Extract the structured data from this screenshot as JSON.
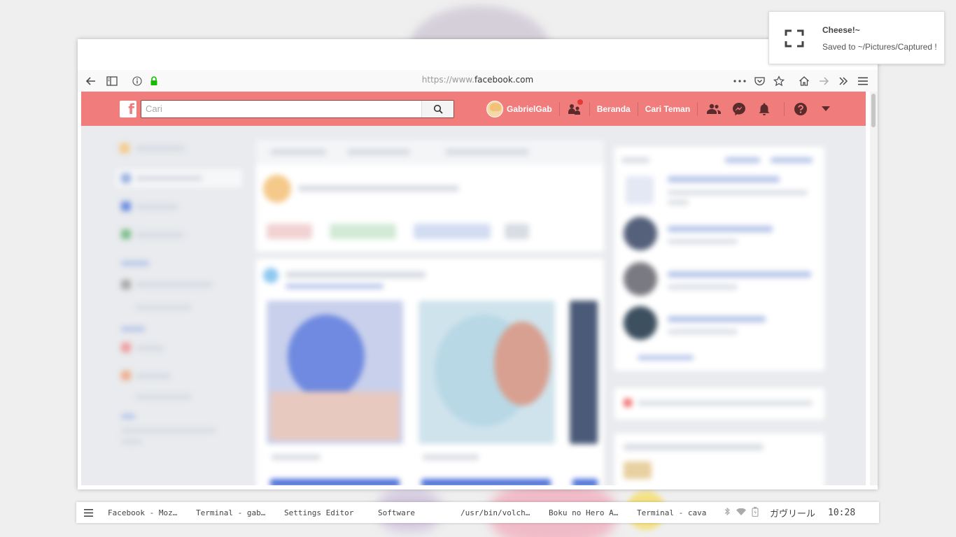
{
  "browser": {
    "url_prefix": "https://www.",
    "url_domain": "facebook.com"
  },
  "facebook": {
    "search_placeholder": "Cari",
    "user_name": "GabrielGab",
    "nav_home": "Beranda",
    "nav_find_friends": "Cari Teman",
    "accent_color": "#f07c7c"
  },
  "notification": {
    "title": "Cheese!~",
    "body": "Saved to ~/Pictures/Captured !"
  },
  "taskbar": {
    "tasks": [
      "Facebook - Moz…",
      "Terminal - gab…",
      "Settings Editor",
      "Software",
      "/usr/bin/volch…",
      "Boku no Hero A…",
      "Terminal - cava"
    ],
    "user": "ガヴリール",
    "clock": "10:28"
  }
}
